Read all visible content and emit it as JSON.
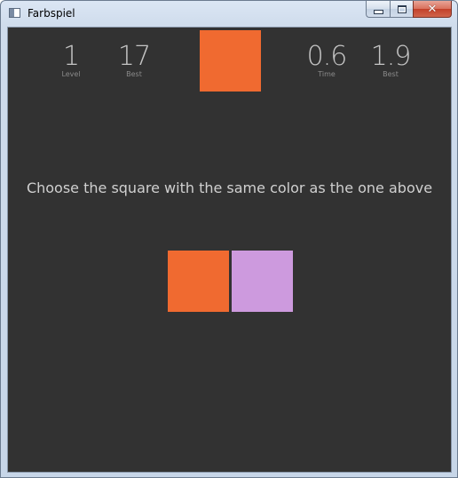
{
  "window": {
    "title": "Farbspiel"
  },
  "stats": {
    "level": {
      "value": "1",
      "label": "Level"
    },
    "level_best": {
      "value": "17",
      "label": "Best"
    },
    "time": {
      "value": "0.6",
      "label": "Time"
    },
    "time_best": {
      "value": "1.9",
      "label": "Best"
    }
  },
  "game": {
    "instruction": "Choose the square with the same color as the one above",
    "target_color": "#f06a30",
    "choices": [
      {
        "color": "#f06a30"
      },
      {
        "color": "#cd9ade"
      }
    ]
  },
  "theme": {
    "background": "#323232"
  }
}
